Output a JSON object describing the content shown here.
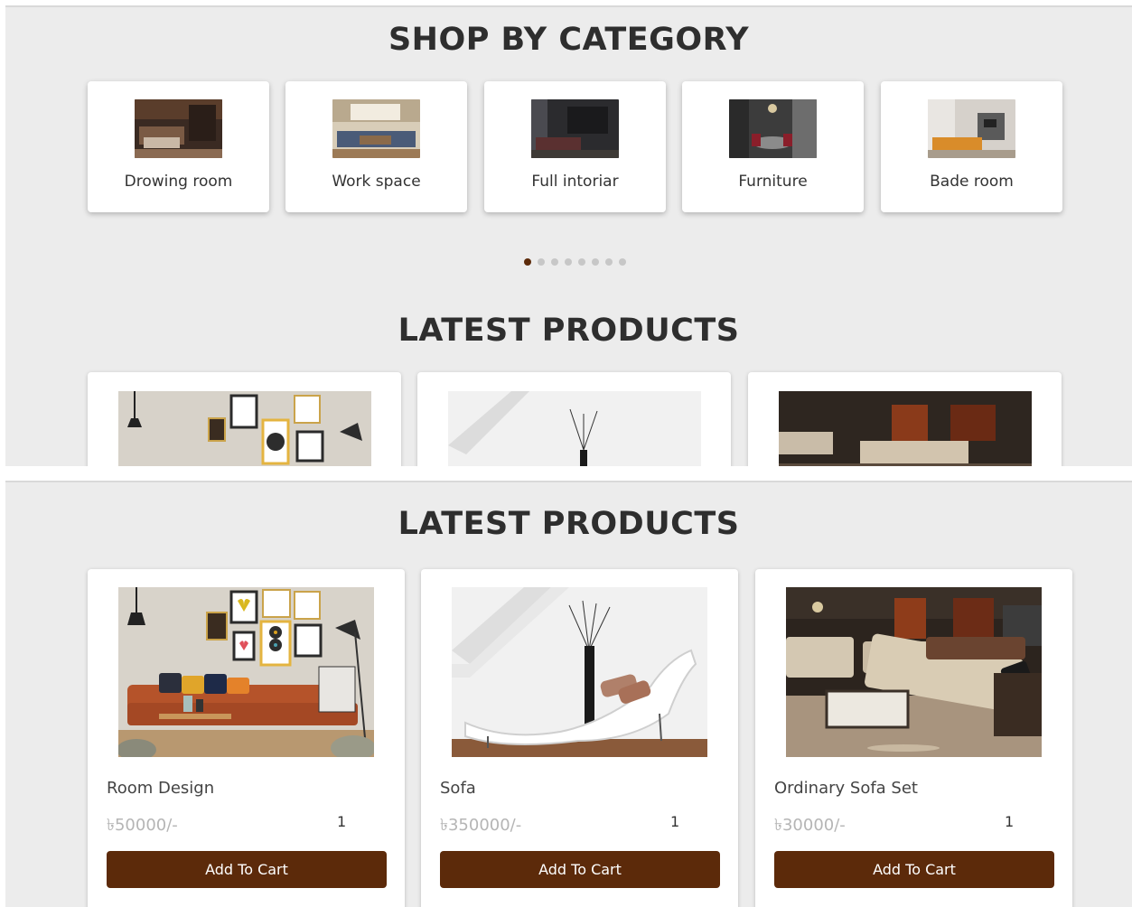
{
  "category_section": {
    "title": "SHOP BY CATEGORY",
    "categories": [
      {
        "label": "Drowing room"
      },
      {
        "label": "Work space"
      },
      {
        "label": "Full intoriar"
      },
      {
        "label": "Furniture"
      },
      {
        "label": "Bade room"
      }
    ],
    "carousel": {
      "total_dots": 8,
      "active_index": 0
    }
  },
  "latest_section_top": {
    "title": "LATEST PRODUCTS"
  },
  "latest_section": {
    "title": "LATEST PRODUCTS",
    "products": [
      {
        "name": "Room Design",
        "price": "৳50000/-",
        "quantity": "1",
        "button_label": "Add To Cart"
      },
      {
        "name": "Sofa",
        "price": "৳350000/-",
        "quantity": "1",
        "button_label": "Add To Cart"
      },
      {
        "name": "Ordinary Sofa Set",
        "price": "৳30000/-",
        "quantity": "1",
        "button_label": "Add To Cart"
      }
    ]
  },
  "colors": {
    "accent": "#5c2a0a",
    "background": "#ececec",
    "card": "#ffffff"
  }
}
